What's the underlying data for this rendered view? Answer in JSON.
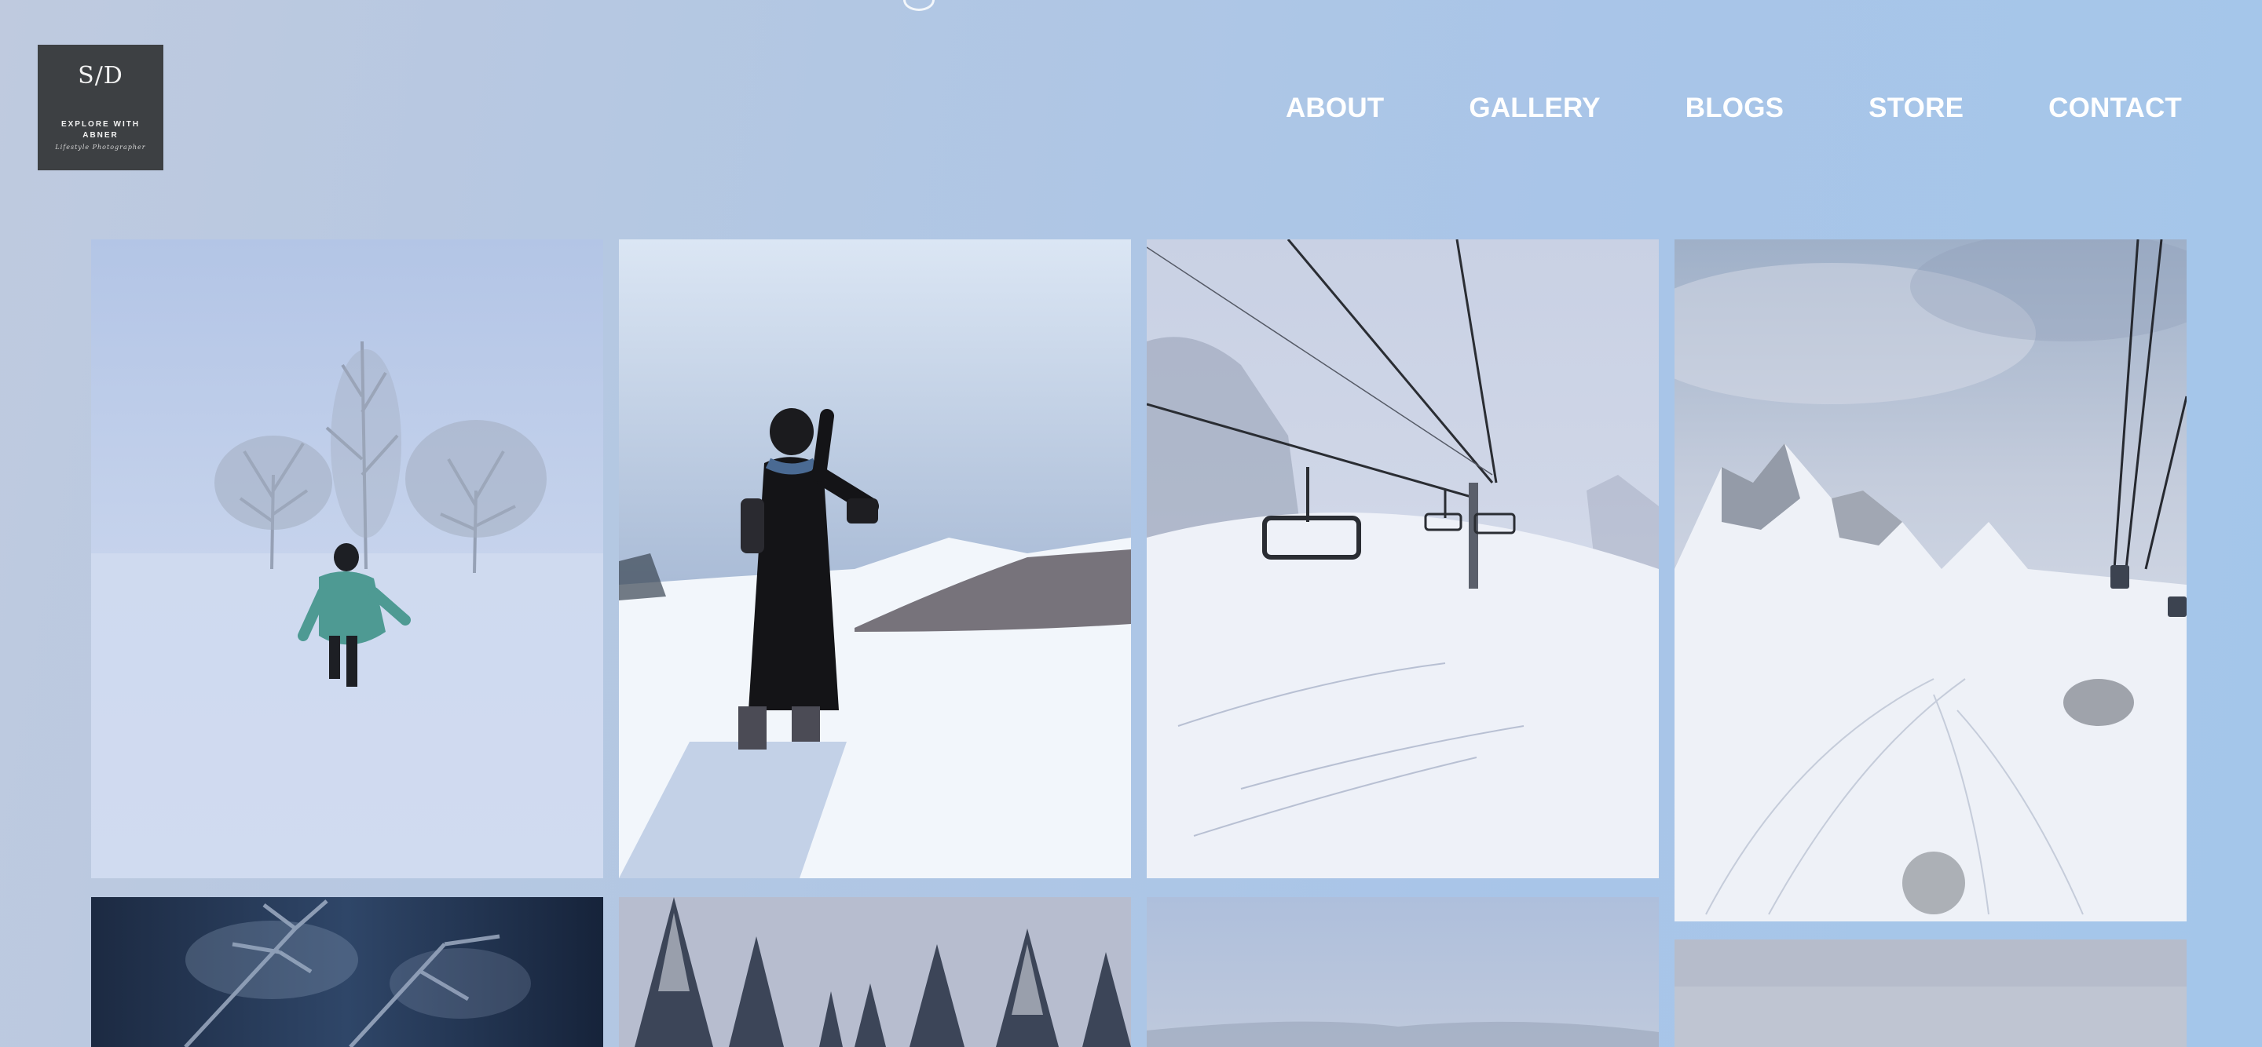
{
  "logo": {
    "mark": "S/D",
    "line1": "EXPLORE WITH",
    "line2": "ABNER",
    "tagline": "Lifestyle Photographer"
  },
  "nav": {
    "items": [
      {
        "label": "ABOUT"
      },
      {
        "label": "GALLERY"
      },
      {
        "label": "BLOGS"
      },
      {
        "label": "STORE"
      },
      {
        "label": "CONTACT"
      }
    ]
  },
  "gallery": {
    "photos": [
      {
        "subject": "person in teal coat walking in snowy field"
      },
      {
        "subject": "photographer in black coat standing in snow"
      },
      {
        "subject": "ski chairlift over snowy slope"
      },
      {
        "subject": "snowy mountains with cable car"
      },
      {
        "subject": "frosted pine branch close-up"
      },
      {
        "subject": "snowy pine forest"
      },
      {
        "subject": "misty snow landscape"
      },
      {
        "subject": "misty snow landscape"
      }
    ]
  },
  "colors": {
    "background": "#a9c5e8",
    "logo_bg": "#3d4043",
    "nav_text": "#ffffff"
  }
}
